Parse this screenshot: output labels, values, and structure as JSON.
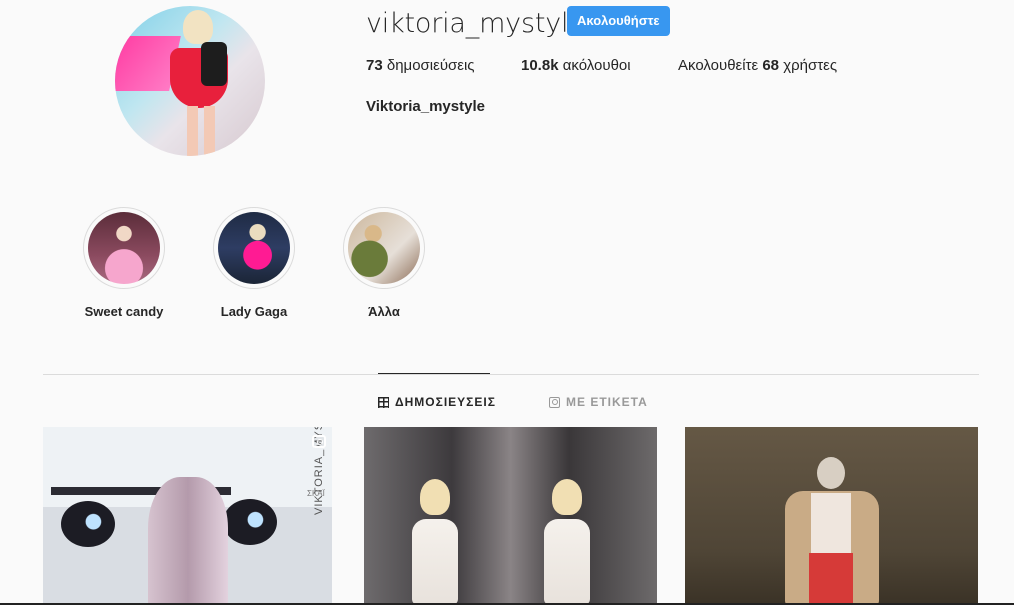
{
  "profile": {
    "username": "viktoria_mystyle",
    "follow_button": "Ακολουθήστε",
    "posts_count": "73",
    "posts_label": "δημοσιεύσεις",
    "followers_count": "10.8k",
    "followers_label": "ακόλουθοι",
    "following_prefix": "Ακολουθείτε",
    "following_count": "68",
    "following_suffix": "χρήστες",
    "full_name": "Viktoria_mystyle"
  },
  "highlights": [
    {
      "label": "Sweet candy"
    },
    {
      "label": "Lady Gaga"
    },
    {
      "label": "Άλλα"
    }
  ],
  "tabs": {
    "posts": "ΔΗΜΟΣΙΕΥΣΕΙΣ",
    "tagged": "ΜΕ ΕΤΙΚΕΤΑ"
  },
  "posts": [
    {
      "watermark": "VIKTORIA_MYSTYLE",
      "channel": "ΣΚΑΪ",
      "icon": "video-icon"
    },
    {
      "icon": null
    },
    {
      "icon": null
    }
  ],
  "colors": {
    "accent": "#3897f0",
    "background": "#fafafa",
    "text": "#262626",
    "muted": "#999999"
  }
}
